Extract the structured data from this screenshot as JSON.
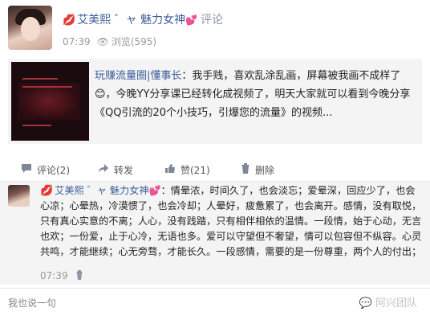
{
  "post": {
    "nickname_prefix": "艾美熙",
    "title_badge": "魅力女神",
    "comment_link": "评论",
    "time": "07:39",
    "views": "浏览(595)"
  },
  "share": {
    "author": "玩赚流量圈|懂事长",
    "text": "：我手贱，喜欢乱涂乱画，屏幕被我画不成样了😊，今晚YY分享课已经转化成视频了，明天大家就可以看到今晚分享《QQ引流的20个小技巧，引爆您的流量》的视频..."
  },
  "actions": {
    "comment": "评论(2)",
    "forward": "转发",
    "like": "赞(21)",
    "delete": "删除"
  },
  "comment": {
    "nickname": "艾美熙",
    "badge": "魅力女神",
    "body": "：情晕浓，时间久了，也会淡忘；爱晕深，回应少了，也会心凉；心晕热，冷漠惯了，也会冷却；人晕好，疲惫累了，也会离开。感情，没有取悦，只有真心实意的不离；人心，没有践踏，只有相伴相依的温情。一段情，始于心动，无言也欢；一份爱，止于心冷，无语也多。爱可以守望但不奢望，情可以包容但不纵容。心灵共鸣，才能继续；心无旁骛，才能长久。一段感情，需要的是一份尊重，两个人的付出；",
    "time": "07:39"
  },
  "reply": {
    "placeholder": "我也说一句",
    "watermark": "阿兴团队"
  }
}
